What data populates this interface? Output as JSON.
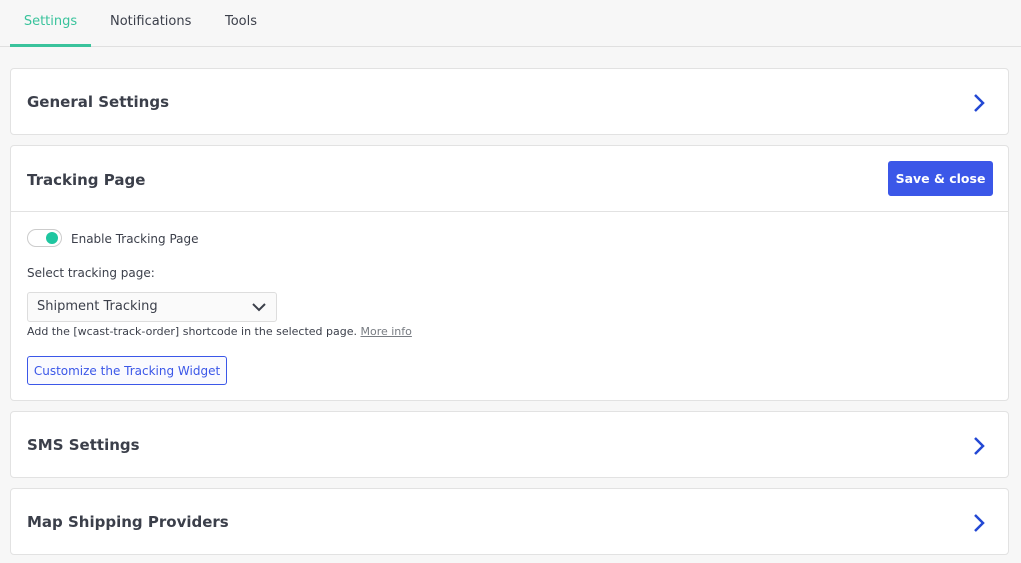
{
  "tabs": [
    {
      "label": "Settings",
      "active": true
    },
    {
      "label": "Notifications",
      "active": false
    },
    {
      "label": "Tools",
      "active": false
    }
  ],
  "sections": {
    "general": {
      "title": "General Settings"
    },
    "tracking": {
      "title": "Tracking Page",
      "save_label": "Save & close",
      "toggle_label": "Enable Tracking Page",
      "toggle_on": true,
      "select_label": "Select tracking page:",
      "select_value": "Shipment Tracking",
      "help_text": "Add the [wcast-track-order] shortcode in the selected page.",
      "help_link": "More info",
      "customize_label": "Customize the Tracking Widget"
    },
    "sms": {
      "title": "SMS Settings"
    },
    "map": {
      "title": "Map Shipping Providers"
    }
  },
  "colors": {
    "accent": "#3ac39c",
    "primary": "#3b57e8"
  }
}
